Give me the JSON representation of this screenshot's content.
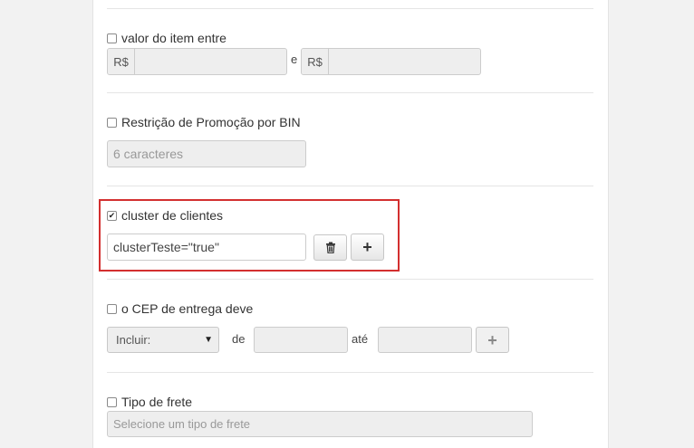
{
  "value_range": {
    "label": "valor do item entre",
    "checked": false,
    "currency_prefix_1": "R$",
    "between_word": "e",
    "currency_prefix_2": "R$"
  },
  "bin_restriction": {
    "label": "Restrição de Promoção por BIN",
    "checked": false,
    "placeholder": "6 caracteres"
  },
  "client_cluster": {
    "label": "cluster de clientes",
    "checked": true,
    "value": "clusterTeste=\"true\"",
    "add_label": "+"
  },
  "cep": {
    "label": "o CEP de entrega deve",
    "checked": false,
    "select_value": "Incluir:",
    "from_word": "de",
    "to_word": "até",
    "add_label": "+"
  },
  "shipping": {
    "label": "Tipo de frete",
    "checked": false,
    "placeholder": "Selecione um tipo de frete"
  },
  "colors": {
    "highlight": "#d32f2f"
  },
  "icons": {
    "trash": "trash-icon",
    "plus": "plus-icon",
    "caret": "caret-down-icon"
  }
}
